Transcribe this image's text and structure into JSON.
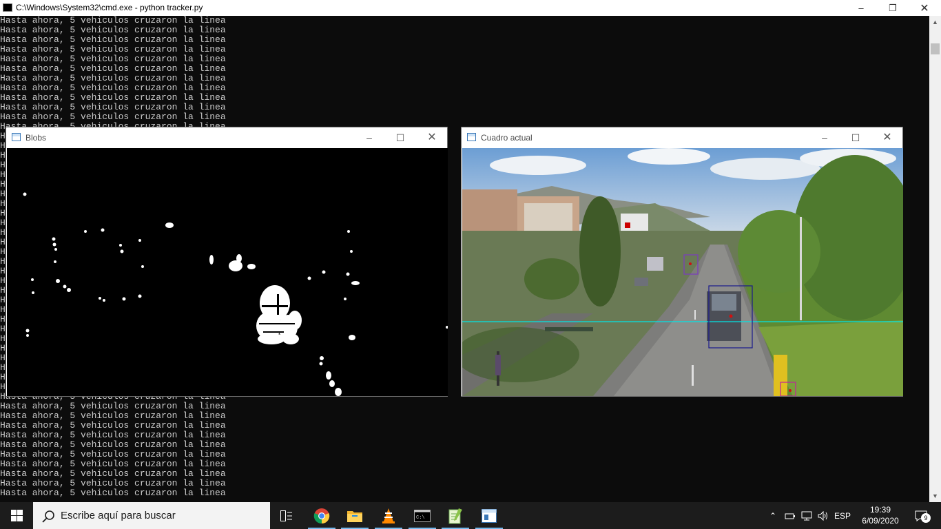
{
  "console": {
    "title": "C:\\Windows\\System32\\cmd.exe - python  tracker.py",
    "line_text": "Hasta ahora, 5 vehiculos cruzaron la linea",
    "clipped_prefix": "H"
  },
  "blobs_window": {
    "title": "Blobs"
  },
  "frame_window": {
    "title": "Cuadro actual"
  },
  "taskbar": {
    "search_placeholder": "Escribe aquí para buscar",
    "apps": [
      "task-view",
      "chrome",
      "file-explorer",
      "vlc",
      "cmd",
      "notepad-plus",
      "python-window"
    ],
    "language": "ESP",
    "time": "19:39",
    "date": "6/09/2020",
    "notifications": "9"
  },
  "colors": {
    "console_bg": "#0c0c0c",
    "console_fg": "#cccccc",
    "taskbar_bg": "#1c1c1c",
    "counting_line": "#00e5e5",
    "vehicle_box": "#1a1a8c"
  }
}
